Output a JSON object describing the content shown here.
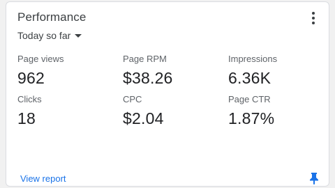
{
  "card": {
    "title": "Performance",
    "more_icon": "more-vertical-icon"
  },
  "range": {
    "selected": "Today so far",
    "caret_icon": "caret-down-icon"
  },
  "metrics": [
    {
      "label": "Page views",
      "value": "962"
    },
    {
      "label": "Page RPM",
      "value": "$38.26"
    },
    {
      "label": "Impressions",
      "value": "6.36K"
    },
    {
      "label": "Clicks",
      "value": "18"
    },
    {
      "label": "CPC",
      "value": "$2.04"
    },
    {
      "label": "Page CTR",
      "value": "1.87%"
    }
  ],
  "footer": {
    "link_label": "View report",
    "pin_icon": "pin-icon"
  },
  "colors": {
    "accent": "#1a73e8",
    "text_primary": "#202124",
    "text_secondary": "#5f6368",
    "border": "#dadce0"
  }
}
